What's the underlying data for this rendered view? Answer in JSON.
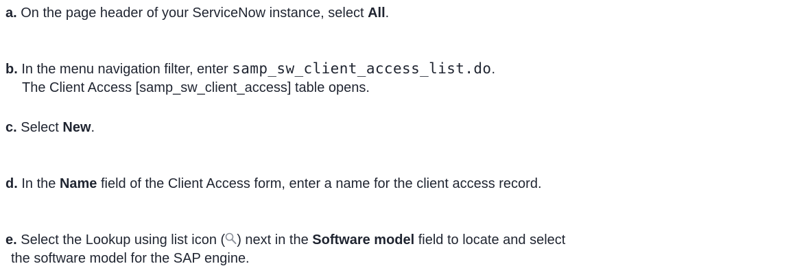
{
  "steps": {
    "a": {
      "letter": "a.",
      "text1": " On the page header of your ServiceNow instance, select ",
      "bold1": "All",
      "text2": "."
    },
    "b": {
      "letter": "b.",
      "text1": " In the menu navigation filter, enter ",
      "code": "samp_sw_client_access_list.do",
      "text2": ".",
      "line2": "The Client Access [samp_sw_client_access] table opens."
    },
    "c": {
      "letter": "c.",
      "text1": " Select ",
      "bold1": "New",
      "text2": "."
    },
    "d": {
      "letter": "d.",
      "text1": " In the ",
      "bold1": "Name",
      "text2": " field of the Client Access form, enter a name for the client access record."
    },
    "e": {
      "letter": "e.",
      "text1": " Select the Lookup using list icon (",
      "icon": "magnifier-icon",
      "text2": ") next in the ",
      "bold1": "Software model",
      "text3": " field to locate and select",
      "line2": "the software model for the SAP engine."
    }
  }
}
